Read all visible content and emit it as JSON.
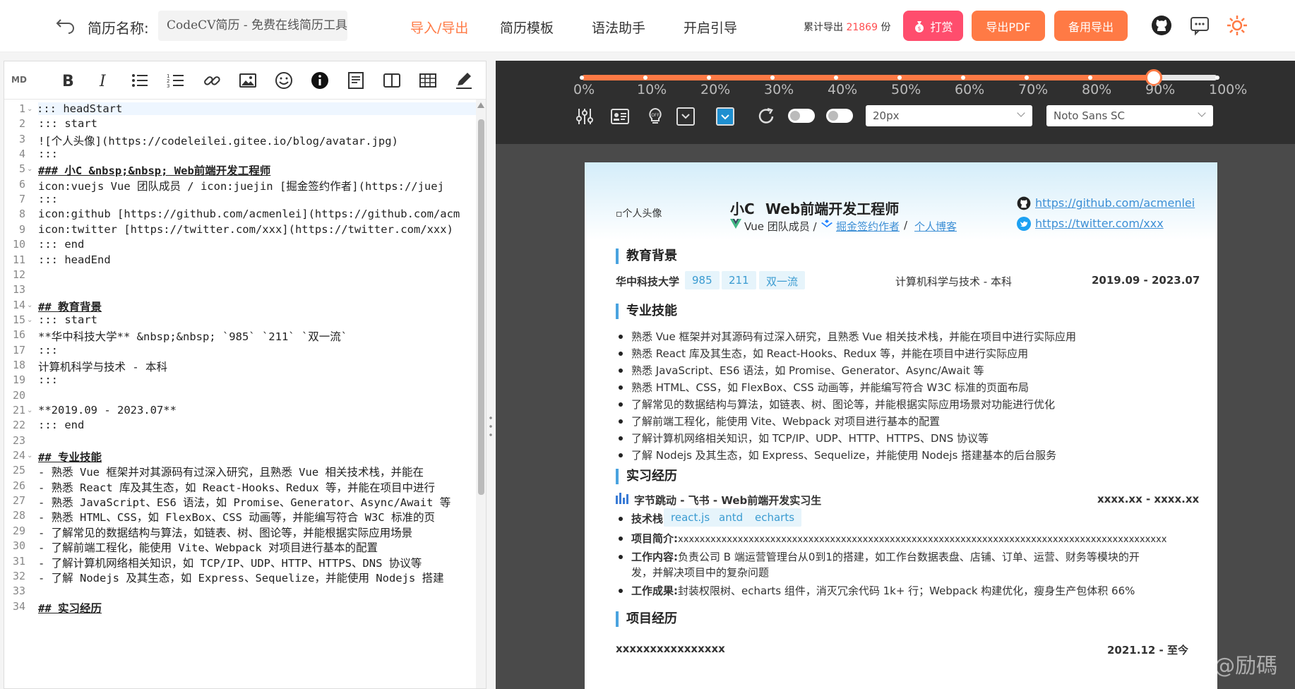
{
  "header": {
    "resume_name_label": "简历名称:",
    "resume_name_value": "CodeCV简历 - 免费在线简历工具",
    "nav": [
      "导入/导出",
      "简历模板",
      "语法助手",
      "开启引导"
    ],
    "export_count_prefix": "累计导出",
    "export_count": "21869",
    "export_count_suffix": "份",
    "buttons": {
      "reward": "打赏",
      "export_pdf": "导出PDF",
      "backup_export": "备用导出"
    },
    "accent_color": "#ff7a45",
    "reward_color": "#ff4d6d"
  },
  "editor": {
    "mode_label": "MD",
    "toolbar_icons": [
      "bold-icon",
      "italic-icon",
      "bullet-list-icon",
      "ordered-list-icon",
      "link-icon",
      "image-icon",
      "emoji-icon",
      "info-icon",
      "code-block-icon",
      "columns-icon",
      "table-icon",
      "pen-icon"
    ],
    "lines": [
      "::: headStart",
      "::: start",
      "![个人头像](https://codeleilei.gitee.io/blog/avatar.jpg)",
      ":::",
      "### 小C &nbsp;&nbsp; Web前端开发工程师",
      "icon:vuejs Vue 团队成员 / icon:juejin [掘金签约作者](https://juej",
      ":::",
      "icon:github [https://github.com/acmenlei](https://github.com/acm",
      "icon:twitter [https://twitter.com/xxx](https://twitter.com/xxx)",
      "::: end",
      "::: headEnd",
      "",
      "",
      "## 教育背景",
      "::: start",
      "**华中科技大学** &nbsp;&nbsp; `985` `211` `双一流`",
      ":::",
      "计算机科学与技术 - 本科",
      ":::",
      "",
      "**2019.09 - 2023.07**",
      "::: end",
      "",
      "## 专业技能",
      "- 熟悉 Vue 框架并对其源码有过深入研究，且熟悉 Vue 相关技术栈，并能在",
      "- 熟悉 React 库及其生态，如 React-Hooks、Redux 等，并能在项目中进行",
      "- 熟悉 JavaScript、ES6 语法，如 Promise、Generator、Async/Await 等",
      "- 熟悉 HTML、CSS，如 FlexBox、CSS 动画等，并能编写符合 W3C 标准的页",
      "- 了解常见的数据结构与算法，如链表、树、图论等，并能根据实际应用场景",
      "- 了解前端工程化，能使用 Vite、Webpack 对项目进行基本的配置",
      "- 了解计算机网络相关知识，如 TCP/IP、UDP、HTTP、HTTPS、DNS 协议等",
      "- 了解 Nodejs 及其生态，如 Express、Sequelize，并能使用 Nodejs 搭建",
      "",
      "## 实习经历"
    ],
    "fold_lines": [
      1,
      5,
      14,
      15,
      21,
      24
    ]
  },
  "preview": {
    "zoom_labels": [
      "0%",
      "10%",
      "20%",
      "30%",
      "40%",
      "50%",
      "60%",
      "70%",
      "80%",
      "90%",
      "100%"
    ],
    "zoom_value": 0.9,
    "font_size_select": "20px",
    "font_family_select": "Noto Sans SC",
    "control_icons": [
      "sliders-icon",
      "id-card-icon",
      "lightbulb-icon",
      "dropdown-box-icon",
      "checkbox-icon",
      "refresh-icon"
    ],
    "resume": {
      "avatar_alt": "个人头像",
      "name": "小C",
      "title": "Web前端开发工程师",
      "subline_vue": "Vue 团队成员 /",
      "subline_juejin": "掘金签约作者",
      "subline_sep": "/",
      "subline_blog": "个人博客",
      "github": "https://github.com/acmenlei",
      "twitter": "https://twitter.com/xxx",
      "education": {
        "heading": "教育背景",
        "school": "华中科技大学",
        "tags": [
          "985",
          "211",
          "双一流"
        ],
        "major": "计算机科学与技术 - 本科",
        "period": "2019.09 - 2023.07"
      },
      "skills": {
        "heading": "专业技能",
        "items": [
          "熟悉 Vue 框架并对其源码有过深入研究，且熟悉 Vue 相关技术栈，并能在项目中进行实际应用",
          "熟悉 React 库及其生态，如 React-Hooks、Redux 等，并能在项目中进行实际应用",
          "熟悉 JavaScript、ES6 语法，如 Promise、Generator、Async/Await 等",
          "熟悉 HTML、CSS，如 FlexBox、CSS 动画等，并能编写符合 W3C 标准的页面布局",
          "了解常见的数据结构与算法，如链表、树、图论等，并能根据实际应用场景对功能进行优化",
          "了解前端工程化，能使用 Vite、Webpack 对项目进行基本的配置",
          "了解计算机网络相关知识，如 TCP/IP、UDP、HTTP、HTTPS、DNS 协议等",
          "了解 Nodejs 及其生态，如 Express、Sequelize，并能使用 Nodejs 搭建基本的后台服务"
        ]
      },
      "internship": {
        "heading": "实习经历",
        "company": "字节跳动 - 飞书 - Web前端开发实习生",
        "period": "xxxx.xx - xxxx.xx",
        "stack_label": "技术栈",
        "stack_tags": [
          "react.js",
          "antd",
          "echarts"
        ],
        "intro_label": "项目简介",
        "intro": "xxxxxxxxxxxxxxxxxxxxxxxxxxxxxxxxxxxxxxxxxxxxxxxxxxxxxxxxxxxxxxxxxxxxxxxxxxxxxxxxxxxxxxxxxx",
        "work_label": "工作内容",
        "work_line1": "负责公司 B 端运营管理台从0到1的搭建，如工作台数据表盘、店铺、订单、运营、财务等模块的开",
        "work_line2": "发，并解决项目中的复杂问题",
        "result_label": "工作成果",
        "result": "封装权限树、echarts 组件，消灭冗余代码 1k+ 行；Webpack 构建优化，瘦身生产包体积 66%"
      },
      "project": {
        "heading": "项目经历",
        "first_item": "xxxxxxxxxxxxxxxx",
        "first_period": "2021.12 - 至今"
      }
    }
  },
  "watermark": "CSDN @励碼"
}
